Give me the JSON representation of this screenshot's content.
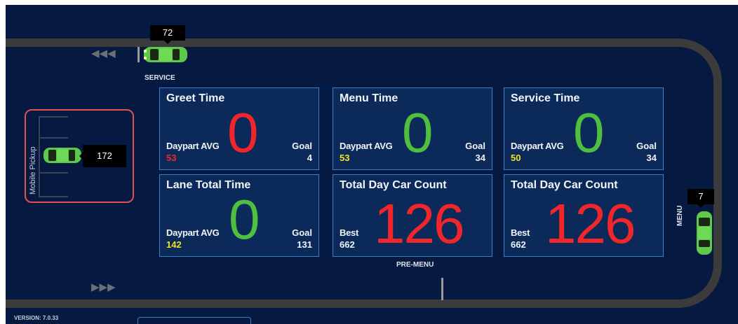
{
  "lane": {
    "service_label": "SERVICE",
    "menu_label": "MENU",
    "premenu_label": "PRE-MENU",
    "service_car_time": "72",
    "menu_car_time": "7"
  },
  "mobile_pickup": {
    "label": "Mobile Pickup",
    "car_time": "172",
    "border_color": "#e05252"
  },
  "tiles": [
    {
      "title": "Greet Time",
      "value": "0",
      "value_color": "#f0262b",
      "avg_label": "Daypart AVG",
      "avg_value": "53",
      "avg_color": "#f0262b",
      "goal_label": "Goal",
      "goal_value": "4"
    },
    {
      "title": "Menu Time",
      "value": "0",
      "value_color": "#4fbf3f",
      "avg_label": "Daypart AVG",
      "avg_value": "53",
      "avg_color": "#f3e321",
      "goal_label": "Goal",
      "goal_value": "34"
    },
    {
      "title": "Service Time",
      "value": "0",
      "value_color": "#4fbf3f",
      "avg_label": "Daypart AVG",
      "avg_value": "50",
      "avg_color": "#f3e321",
      "goal_label": "Goal",
      "goal_value": "34"
    },
    {
      "title": "Lane Total Time",
      "value": "0",
      "value_color": "#4fbf3f",
      "avg_label": "Daypart AVG",
      "avg_value": "142",
      "avg_color": "#f3e321",
      "goal_label": "Goal",
      "goal_value": "131"
    },
    {
      "title": "Total Day Car Count",
      "value": "126",
      "value_color": "#f0262b",
      "best_label": "Best",
      "best_value": "662"
    },
    {
      "title": "Total Day Car Count",
      "value": "126",
      "value_color": "#f0262b",
      "best_label": "Best",
      "best_value": "662"
    }
  ],
  "footer": {
    "version": "VERSION: 7.0.33"
  },
  "colors": {
    "background": "#061940",
    "track": "#3b3b3b",
    "tile_border": "#3a7fc9",
    "car": "#5ec94a"
  }
}
